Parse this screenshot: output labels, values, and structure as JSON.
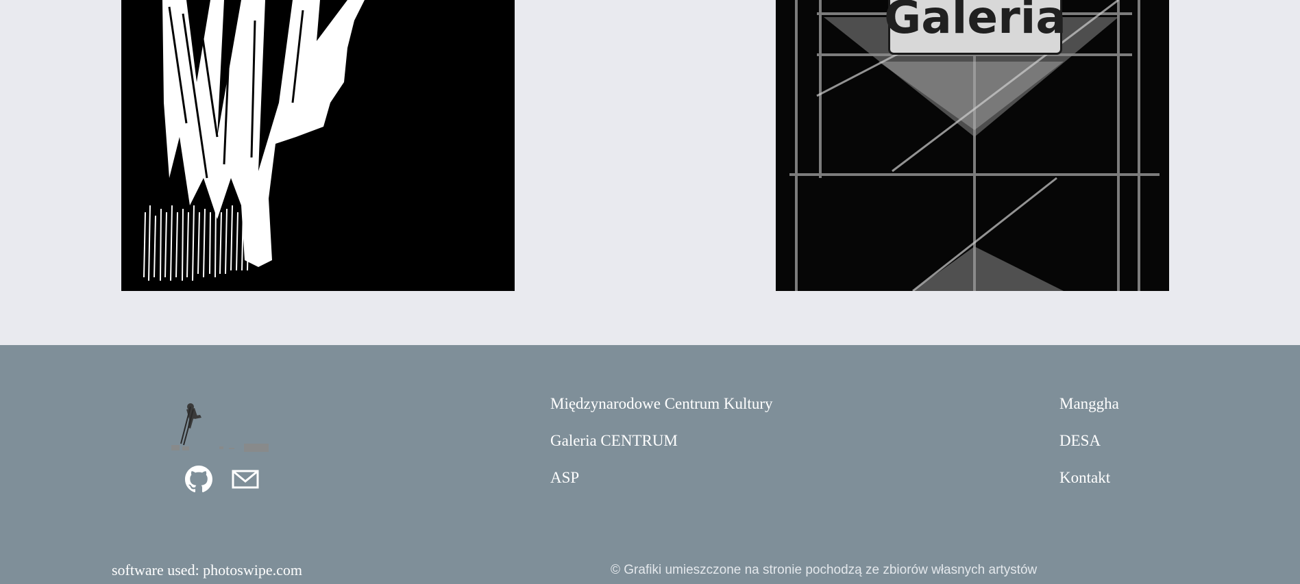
{
  "gallery": {
    "label": "Galeria"
  },
  "footer": {
    "social_icons": [
      "github-icon",
      "mail-icon"
    ],
    "links_middle": [
      "Międzynarodowe Centrum Kultury",
      "Galeria CENTRUM",
      "ASP"
    ],
    "links_right": [
      "Manggha",
      "DESA",
      "Kontakt"
    ],
    "software_text": "software used: photoswipe.com",
    "copyright_text": "© Grafiki umieszczone na stronie pochodzą ze zbiorów własnych artystów"
  },
  "colors": {
    "page_bg": "#e9eaef",
    "footer_bg": "#7f8f99",
    "link_text": "#ffffff"
  }
}
